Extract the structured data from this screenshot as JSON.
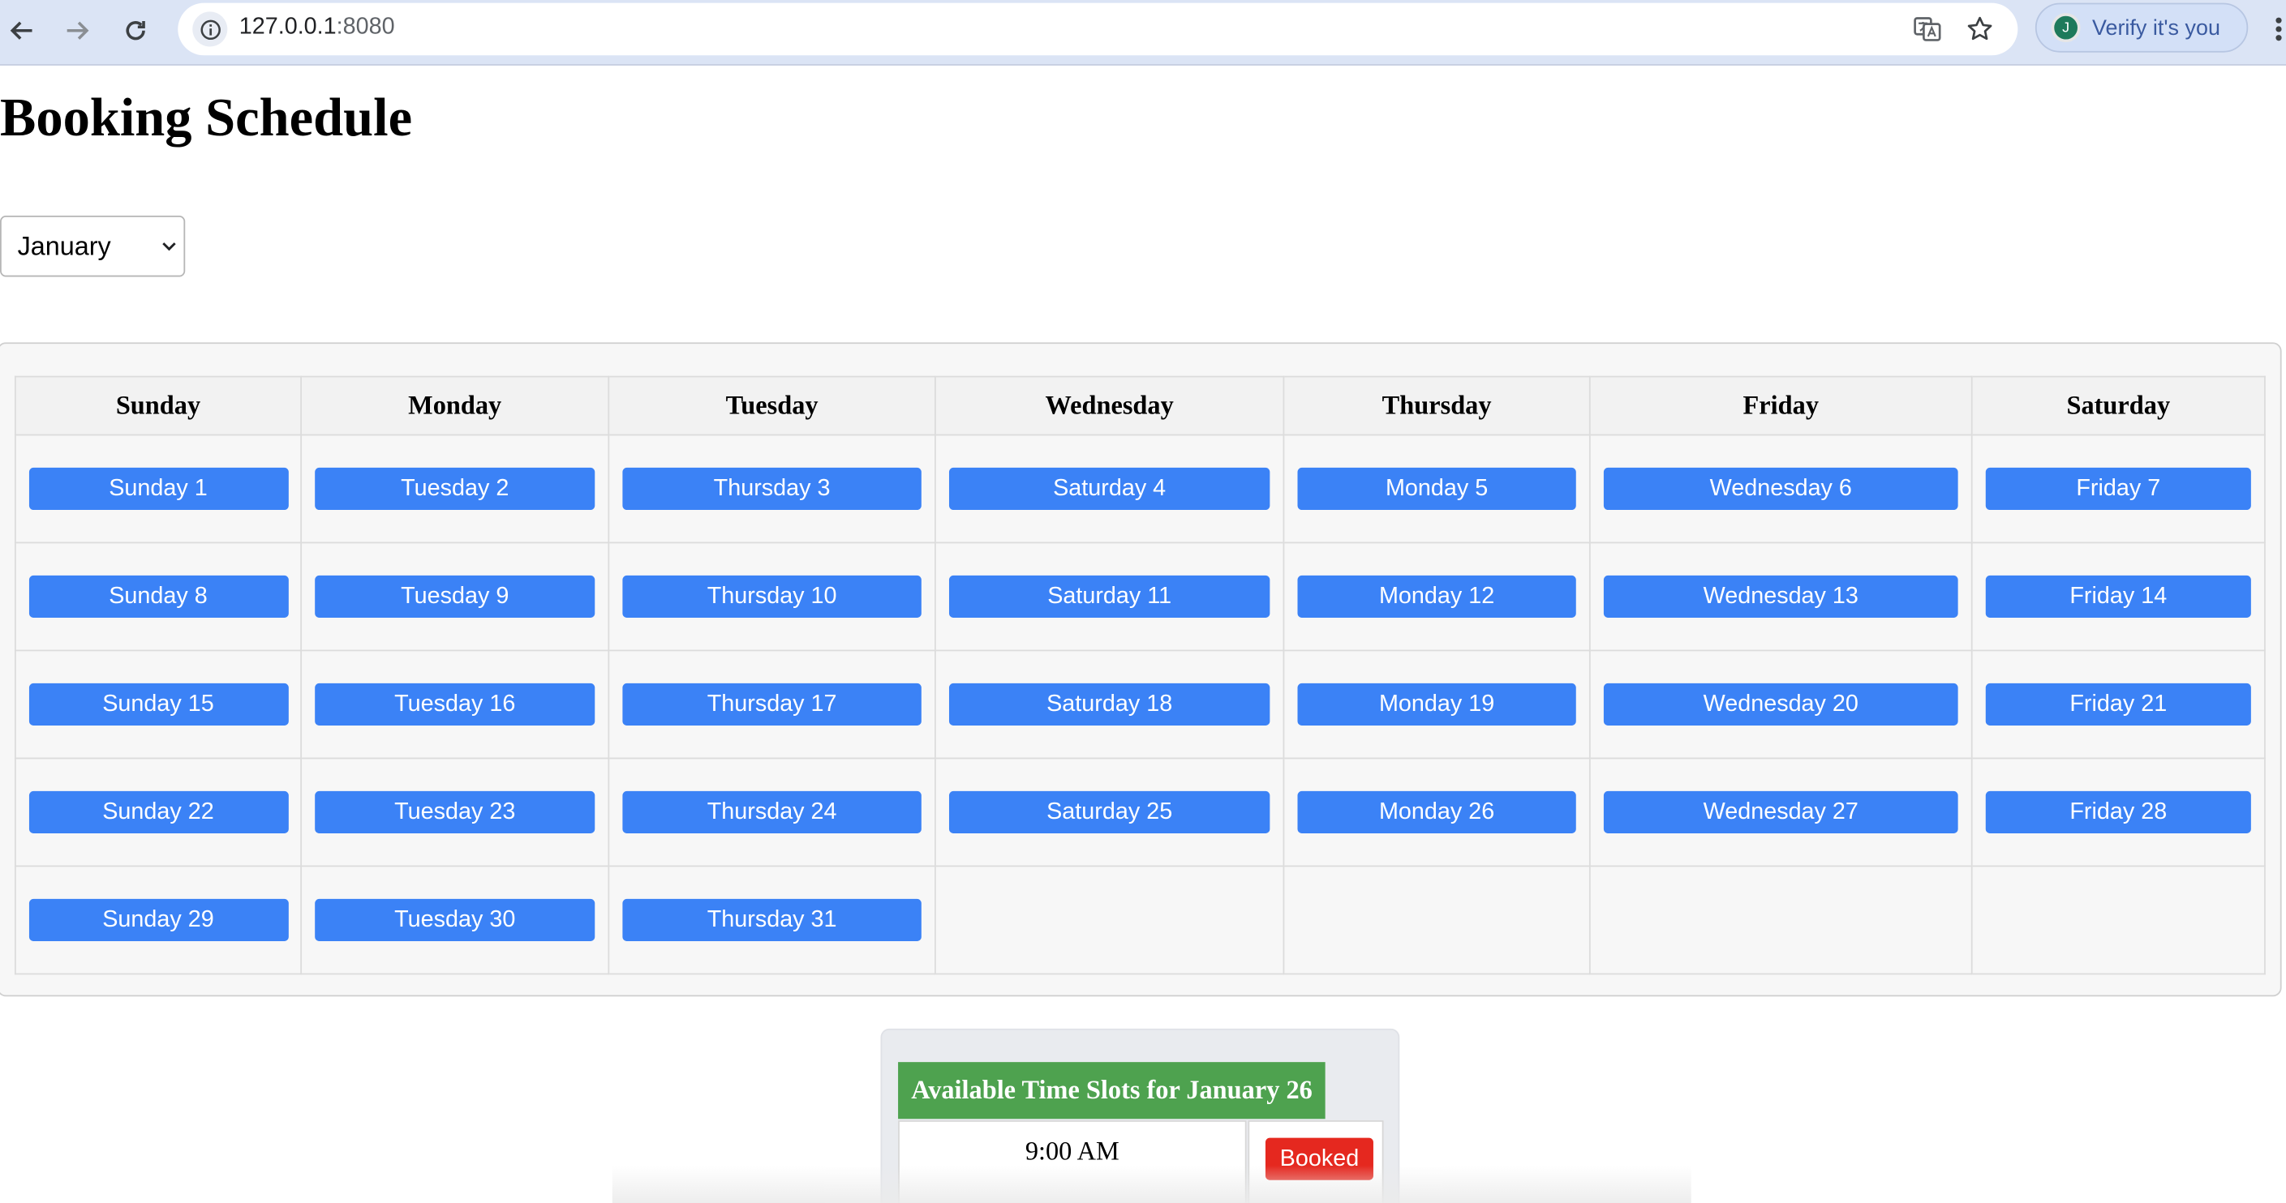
{
  "browser": {
    "url_host": "127.0.0.1",
    "url_port": ":8080",
    "profile_label": "Verify it's you",
    "profile_initial": "J"
  },
  "page": {
    "title": "Booking Schedule",
    "month_selected": "January"
  },
  "calendar": {
    "headers": [
      "Sunday",
      "Monday",
      "Tuesday",
      "Wednesday",
      "Thursday",
      "Friday",
      "Saturday"
    ],
    "weeks": [
      [
        "Sunday 1",
        "Tuesday 2",
        "Thursday 3",
        "Saturday 4",
        "Monday 5",
        "Wednesday 6",
        "Friday 7"
      ],
      [
        "Sunday 8",
        "Tuesday 9",
        "Thursday 10",
        "Saturday 11",
        "Monday 12",
        "Wednesday 13",
        "Friday 14"
      ],
      [
        "Sunday 15",
        "Tuesday 16",
        "Thursday 17",
        "Saturday 18",
        "Monday 19",
        "Wednesday 20",
        "Friday 21"
      ],
      [
        "Sunday 22",
        "Tuesday 23",
        "Thursday 24",
        "Saturday 25",
        "Monday 26",
        "Wednesday 27",
        "Friday 28"
      ],
      [
        "Sunday 29",
        "Tuesday 30",
        "Thursday 31",
        "",
        "",
        "",
        ""
      ]
    ],
    "button_color": "#3b82f6"
  },
  "time_slots": {
    "title": "Available Time Slots for January 26",
    "slots": [
      {
        "time": "9:00 AM",
        "status": "Booked"
      }
    ],
    "title_color": "#4ea24f",
    "booked_color": "#e5281f"
  }
}
